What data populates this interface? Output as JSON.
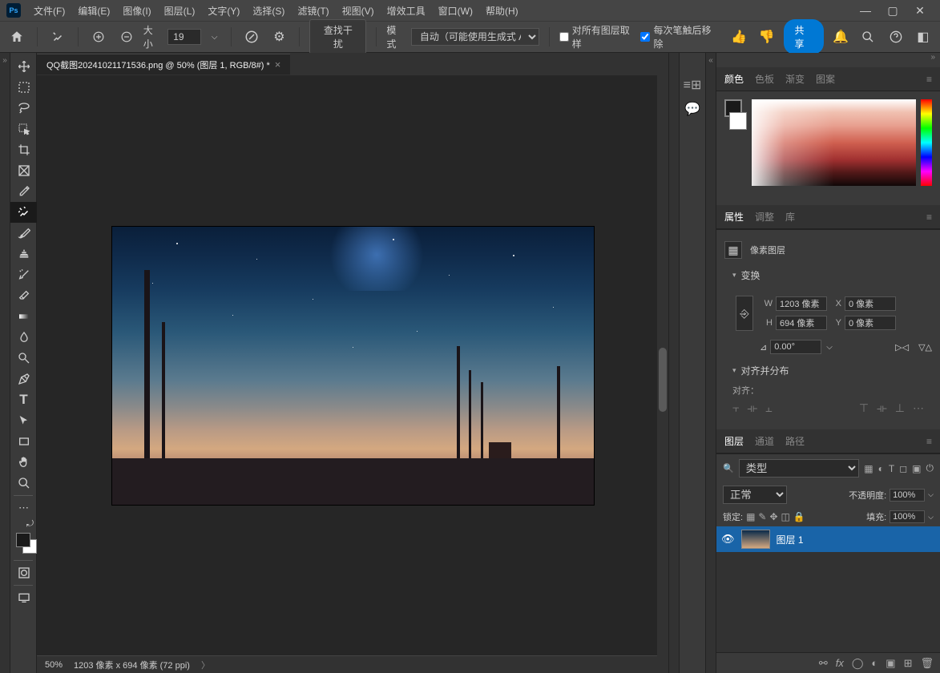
{
  "menubar": {
    "items": [
      "文件(F)",
      "编辑(E)",
      "图像(I)",
      "图层(L)",
      "文字(Y)",
      "选择(S)",
      "滤镜(T)",
      "视图(V)",
      "增效工具",
      "窗口(W)",
      "帮助(H)"
    ]
  },
  "optbar": {
    "size_label": "大小",
    "size_value": "19",
    "find_btn": "查找干扰",
    "mode_label": "模式",
    "mode_value": "自动（可能使用生成式 AI）",
    "sample_all": "对所有图层取样",
    "remove_after": "每次笔触后移除",
    "share": "共享"
  },
  "doc": {
    "tab": "QQ截图20241021171536.png @ 50% (图层 1, RGB/8#) *",
    "zoom": "50%",
    "dim": "1203 像素 x 694 像素 (72 ppi)"
  },
  "color_panel": {
    "tabs": [
      "颜色",
      "色板",
      "渐变",
      "图案"
    ]
  },
  "prop_panel": {
    "tabs": [
      "属性",
      "调整",
      "库"
    ],
    "type": "像素图层",
    "section": "变换",
    "w_lbl": "W",
    "w": "1203 像素",
    "h_lbl": "H",
    "h": "694 像素",
    "x_lbl": "X",
    "x": "0 像素",
    "y_lbl": "Y",
    "y": "0 像素",
    "angle": "0.00°",
    "align_section": "对齐并分布",
    "align_lbl": "对齐："
  },
  "layers": {
    "tabs": [
      "图层",
      "通道",
      "路径"
    ],
    "kind": "类型",
    "blend": "正常",
    "opacity_lbl": "不透明度:",
    "opacity": "100%",
    "lock_lbl": "锁定:",
    "fill_lbl": "填充:",
    "fill": "100%",
    "item": "图层 1"
  }
}
